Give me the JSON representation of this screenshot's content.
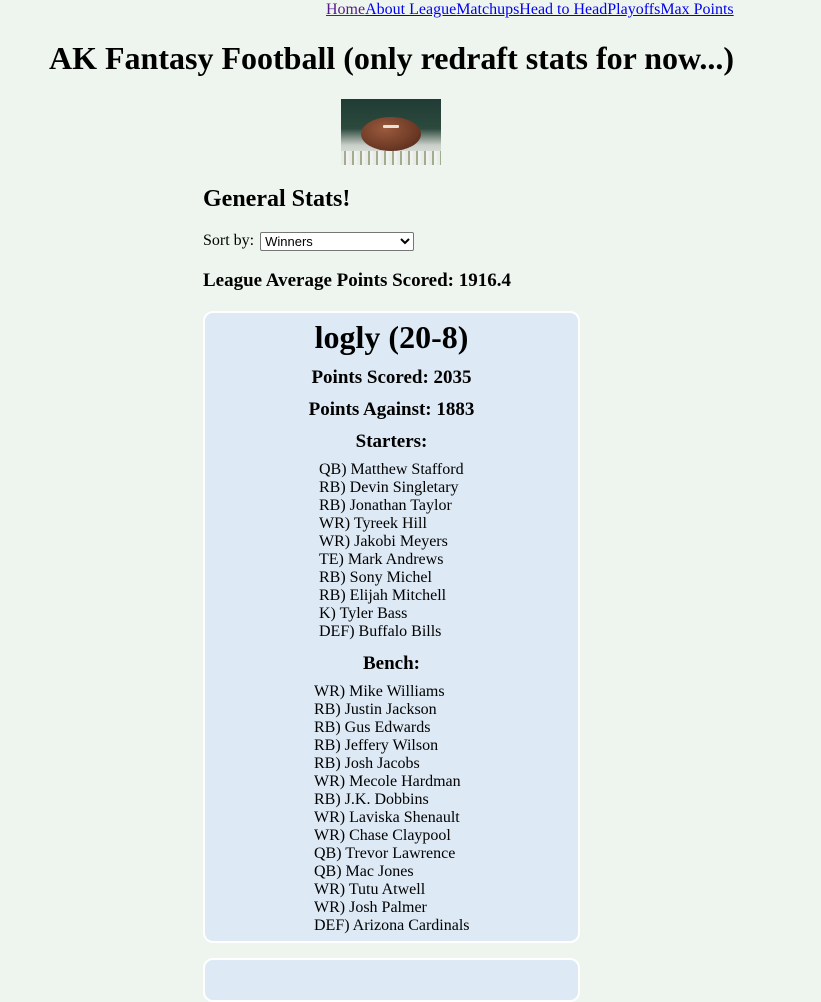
{
  "nav": {
    "items": [
      {
        "label": "Home"
      },
      {
        "label": "About League"
      },
      {
        "label": "Matchups"
      },
      {
        "label": "Head to Head"
      },
      {
        "label": "Playoffs"
      },
      {
        "label": "Max Points"
      }
    ]
  },
  "site_title": "AK Fantasy Football (only redraft stats for now...)",
  "hero_image": {
    "icon": "football-in-snow-image"
  },
  "section_title": "General Stats!",
  "sort": {
    "label": "Sort by:",
    "selected": "Winners"
  },
  "league_average": "League Average Points Scored: 1916.4",
  "team_card": {
    "title": "logly (20-8)",
    "points_scored": "Points Scored: 2035",
    "points_against": "Points Against: 1883",
    "starters_label": "Starters:",
    "starters": [
      "QB) Matthew Stafford",
      "RB) Devin Singletary",
      "RB) Jonathan Taylor",
      "WR) Tyreek Hill",
      "WR) Jakobi Meyers",
      "TE) Mark Andrews",
      "RB) Sony Michel",
      "RB) Elijah Mitchell",
      "K) Tyler Bass",
      "DEF) Buffalo Bills"
    ],
    "bench_label": "Bench:",
    "bench": [
      "WR) Mike Williams",
      "RB) Justin Jackson",
      "RB) Gus Edwards",
      "RB) Jeffery Wilson",
      "RB) Josh Jacobs",
      "WR) Mecole Hardman",
      "RB) J.K. Dobbins",
      "WR) Laviska Shenault",
      "WR) Chase Claypool",
      "QB) Trevor Lawrence",
      "QB) Mac Jones",
      "WR) Tutu Atwell",
      "WR) Josh Palmer",
      "DEF) Arizona Cardinals"
    ]
  }
}
